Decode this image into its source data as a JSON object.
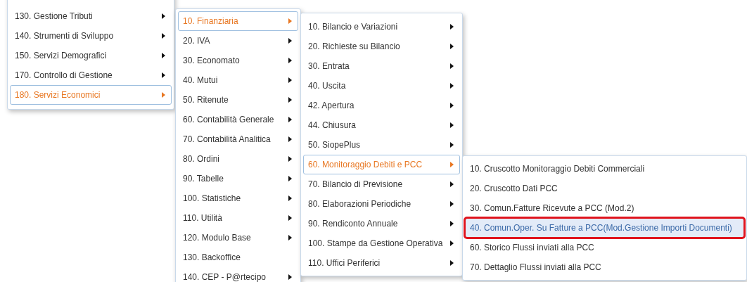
{
  "menus": [
    {
      "items": [
        {
          "label": "130. Gestione Tributi",
          "has_submenu": true,
          "selected": false
        },
        {
          "label": "140. Strumenti di Sviluppo",
          "has_submenu": true,
          "selected": false
        },
        {
          "label": "150. Servizi Demografici",
          "has_submenu": true,
          "selected": false
        },
        {
          "label": "170. Controllo di Gestione",
          "has_submenu": true,
          "selected": false
        },
        {
          "label": "180. Servizi Economici",
          "has_submenu": true,
          "selected": true
        }
      ]
    },
    {
      "items": [
        {
          "label": "10. Finanziaria",
          "has_submenu": true,
          "selected": true
        },
        {
          "label": "20. IVA",
          "has_submenu": true,
          "selected": false
        },
        {
          "label": "30. Economato",
          "has_submenu": true,
          "selected": false
        },
        {
          "label": "40. Mutui",
          "has_submenu": true,
          "selected": false
        },
        {
          "label": "50. Ritenute",
          "has_submenu": true,
          "selected": false
        },
        {
          "label": "60. Contabilità Generale",
          "has_submenu": true,
          "selected": false
        },
        {
          "label": "70. Contabilità Analitica",
          "has_submenu": true,
          "selected": false
        },
        {
          "label": "80. Ordini",
          "has_submenu": true,
          "selected": false
        },
        {
          "label": "90. Tabelle",
          "has_submenu": true,
          "selected": false
        },
        {
          "label": "100. Statistiche",
          "has_submenu": true,
          "selected": false
        },
        {
          "label": "110. Utilità",
          "has_submenu": true,
          "selected": false
        },
        {
          "label": "120. Modulo Base",
          "has_submenu": true,
          "selected": false
        },
        {
          "label": "130. Backoffice",
          "has_submenu": false,
          "selected": false
        },
        {
          "label": "140. CEP - P@rtecipo",
          "has_submenu": true,
          "selected": false
        }
      ]
    },
    {
      "items": [
        {
          "label": "10. Bilancio e Variazioni",
          "has_submenu": true,
          "selected": false
        },
        {
          "label": "20. Richieste su Bilancio",
          "has_submenu": true,
          "selected": false
        },
        {
          "label": "30. Entrata",
          "has_submenu": true,
          "selected": false
        },
        {
          "label": "40. Uscita",
          "has_submenu": true,
          "selected": false
        },
        {
          "label": "42. Apertura",
          "has_submenu": true,
          "selected": false
        },
        {
          "label": "44. Chiusura",
          "has_submenu": true,
          "selected": false
        },
        {
          "label": "50. SiopePlus",
          "has_submenu": true,
          "selected": false
        },
        {
          "label": "60. Monitoraggio Debiti e PCC",
          "has_submenu": true,
          "selected": true
        },
        {
          "label": "70. Bilancio di Previsione",
          "has_submenu": true,
          "selected": false
        },
        {
          "label": "80. Elaborazioni Periodiche",
          "has_submenu": true,
          "selected": false
        },
        {
          "label": "90. Rendiconto Annuale",
          "has_submenu": true,
          "selected": false
        },
        {
          "label": "100. Stampe da Gestione Operativa",
          "has_submenu": true,
          "selected": false
        },
        {
          "label": "110. Uffici Periferici",
          "has_submenu": true,
          "selected": false
        }
      ]
    },
    {
      "items": [
        {
          "label": "10. Cruscotto Monitoraggio Debiti Commerciali",
          "has_submenu": false,
          "selected": false
        },
        {
          "label": "20. Cruscotto Dati PCC",
          "has_submenu": false,
          "selected": false
        },
        {
          "label": "30. Comun.Fatture Ricevute a PCC (Mod.2)",
          "has_submenu": false,
          "selected": false
        },
        {
          "label": "40. Comun.Oper. Su Fatture a PCC(Mod.Gestione Importi Documenti)",
          "has_submenu": false,
          "selected": true,
          "annotated": true
        },
        {
          "label": "60. Storico Flussi inviati alla PCC",
          "has_submenu": false,
          "selected": false
        },
        {
          "label": "70. Dettaglio Flussi inviati alla PCC",
          "has_submenu": false,
          "selected": false
        }
      ]
    }
  ]
}
